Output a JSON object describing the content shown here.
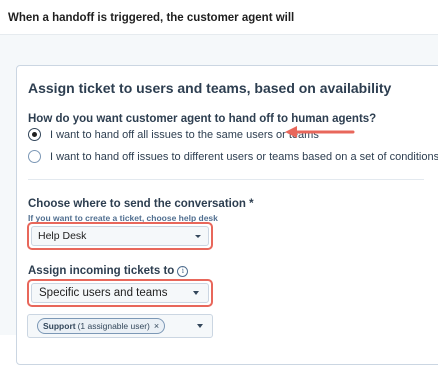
{
  "header": {
    "heading": "When a handoff is triggered, the customer agent will"
  },
  "card": {
    "title": "Assign ticket to users and teams, based on availability",
    "question": "How do you want customer agent to hand off to human agents?",
    "options": [
      {
        "label": "I want to hand off all issues to the same users or teams",
        "selected": true
      },
      {
        "label": "I want to hand off issues to different users or teams based on a set of conditions",
        "selected": false
      }
    ],
    "destination": {
      "label": "Choose where to send the conversation *",
      "help": "If you want to create a ticket, choose help desk",
      "value": "Help Desk"
    },
    "assign": {
      "label": "Assign incoming tickets to",
      "value": "Specific users and teams"
    },
    "assignees": {
      "tag_name": "Support",
      "tag_detail": "(1 assignable user)",
      "tag_remove": "×"
    }
  },
  "colors": {
    "annotation": "#e8675b",
    "text": "#2d3e50",
    "border": "#cbd6e2"
  }
}
